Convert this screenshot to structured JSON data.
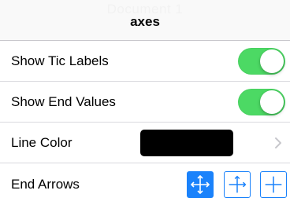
{
  "background": {
    "title_fragment": "Document 1"
  },
  "popover": {
    "title": "axes",
    "rows": [
      {
        "label": "Show Tic Labels",
        "control": "toggle",
        "on": true
      },
      {
        "label": "Show End Values",
        "control": "toggle",
        "on": true
      },
      {
        "label": "Line Color",
        "control": "color",
        "value_color": "#000000",
        "icon": "chevron-right-icon"
      },
      {
        "label": "End Arrows",
        "control": "segmented",
        "options": [
          {
            "icon": "arrows-both-ends-icon",
            "selected": true
          },
          {
            "icon": "arrows-one-end-icon",
            "selected": false
          },
          {
            "icon": "arrows-none-icon",
            "selected": false
          }
        ]
      }
    ]
  },
  "colors": {
    "toggle_on": "#4cd964",
    "accent": "#1a82fb",
    "separator": "#d9d9de",
    "nav_background": "#f7f7f7"
  }
}
